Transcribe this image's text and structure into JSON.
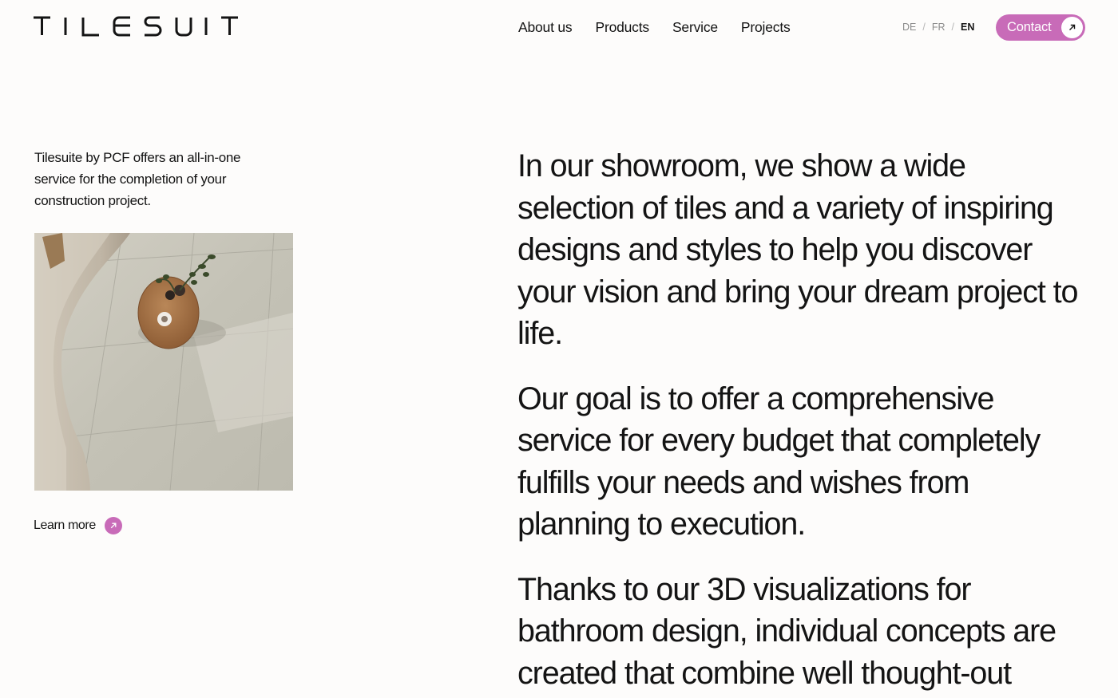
{
  "brand": {
    "name": "TILESUITE"
  },
  "nav": {
    "items": [
      {
        "label": "About us"
      },
      {
        "label": "Products"
      },
      {
        "label": "Service"
      },
      {
        "label": "Projects"
      }
    ]
  },
  "languages": {
    "options": [
      "DE",
      "FR",
      "EN"
    ],
    "separator": "/",
    "active": "EN"
  },
  "contact": {
    "label": "Contact",
    "icon": "arrow-up-right-icon"
  },
  "intro": {
    "text": "Tilesuite by PCF offers an all-in-one service for the completion of your construction project."
  },
  "learn_more": {
    "label": "Learn more",
    "icon": "arrow-up-right-icon"
  },
  "main": {
    "paragraphs": [
      "In our showroom, we show a wide selection of tiles and a variety of inspiring designs and styles to help you discover your vision and bring your dream project to life.",
      "Our goal is to offer a comprehensive service for every budget that completely fulfills your needs and wishes from planning to execution.",
      "Thanks to our 3D visualizations for bathroom design, individual concepts are created that combine well thought-out"
    ]
  },
  "colors": {
    "accent": "#c86bb8",
    "background": "#fdfcfb",
    "text": "#141414"
  }
}
